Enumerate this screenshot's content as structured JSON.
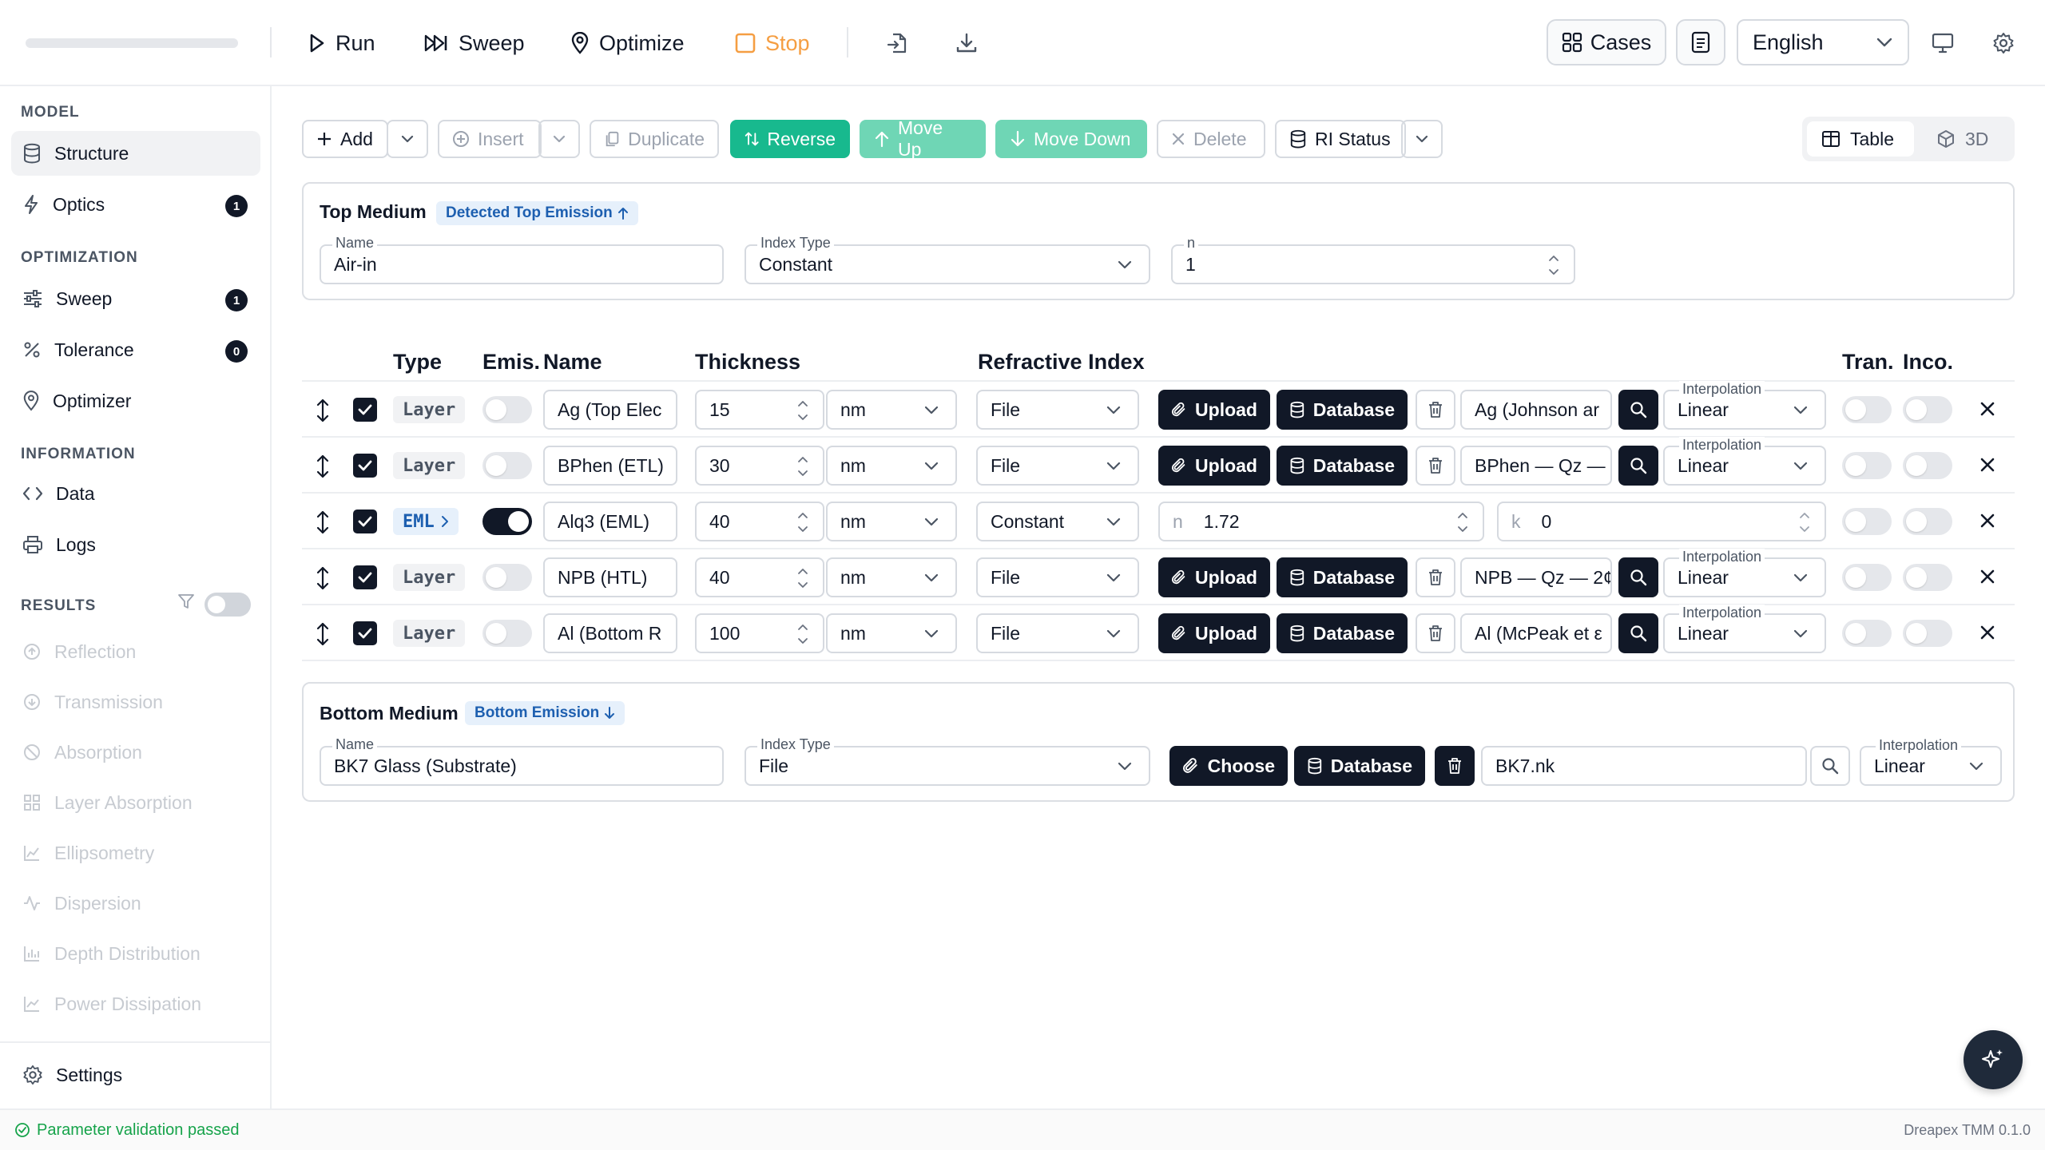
{
  "topbar": {
    "run": "Run",
    "sweep": "Sweep",
    "optimize": "Optimize",
    "stop": "Stop",
    "cases": "Cases",
    "language": "English"
  },
  "sidebar": {
    "model_title": "MODEL",
    "structure": "Structure",
    "optics": "Optics",
    "optics_badge": "1",
    "optimization_title": "OPTIMIZATION",
    "sweep": "Sweep",
    "sweep_badge": "1",
    "tolerance": "Tolerance",
    "tolerance_badge": "0",
    "optimizer": "Optimizer",
    "information_title": "INFORMATION",
    "data": "Data",
    "logs": "Logs",
    "results_title": "RESULTS",
    "results": [
      "Reflection",
      "Transmission",
      "Absorption",
      "Layer Absorption",
      "Ellipsometry",
      "Dispersion",
      "Depth Distribution",
      "Power Dissipation"
    ],
    "settings": "Settings"
  },
  "toolbar": {
    "add": "Add",
    "insert": "Insert",
    "duplicate": "Duplicate",
    "reverse": "Reverse",
    "move_up": "Move Up",
    "move_down": "Move Down",
    "delete": "Delete",
    "ri_status": "RI Status",
    "view_table": "Table",
    "view_3d": "3D"
  },
  "top_medium": {
    "title": "Top Medium",
    "tag": "Detected Top Emission",
    "name_label": "Name",
    "name": "Air-in",
    "index_type_label": "Index Type",
    "index_type": "Constant",
    "n_label": "n",
    "n": "1"
  },
  "table": {
    "headers": {
      "type": "Type",
      "emis": "Emis.",
      "name": "Name",
      "thickness": "Thickness",
      "ri": "Refractive Index",
      "tran": "Tran.",
      "inco": "Inco."
    },
    "upload": "Upload",
    "database": "Database",
    "interp_label": "Interpolation",
    "rows": [
      {
        "type": "Layer",
        "name": "Ag (Top Elec",
        "thickness": "15",
        "unit": "nm",
        "ri_mode": "File",
        "material": "Ag (Johnson ar",
        "interp": "Linear"
      },
      {
        "type": "Layer",
        "name": "BPhen (ETL)",
        "thickness": "30",
        "unit": "nm",
        "ri_mode": "File",
        "material": "BPhen — Qz —",
        "interp": "Linear"
      },
      {
        "type": "EML",
        "name": "Alq3 (EML)",
        "thickness": "40",
        "unit": "nm",
        "ri_mode": "Constant",
        "n_label": "n",
        "n": "1.72",
        "k_label": "k",
        "k": "0"
      },
      {
        "type": "Layer",
        "name": "NPB (HTL)",
        "thickness": "40",
        "unit": "nm",
        "ri_mode": "File",
        "material": "NPB — Qz — 2¢",
        "interp": "Linear"
      },
      {
        "type": "Layer",
        "name": "Al (Bottom R",
        "thickness": "100",
        "unit": "nm",
        "ri_mode": "File",
        "material": "Al (McPeak et ε",
        "interp": "Linear"
      }
    ]
  },
  "bottom_medium": {
    "title": "Bottom Medium",
    "tag": "Bottom Emission",
    "name_label": "Name",
    "name": "BK7 Glass (Substrate)",
    "index_type_label": "Index Type",
    "index_type": "File",
    "choose": "Choose",
    "database": "Database",
    "file": "BK7.nk",
    "interp_label": "Interpolation",
    "interp": "Linear"
  },
  "status": {
    "message": "Parameter validation passed",
    "version": "Dreapex TMM 0.1.0"
  }
}
